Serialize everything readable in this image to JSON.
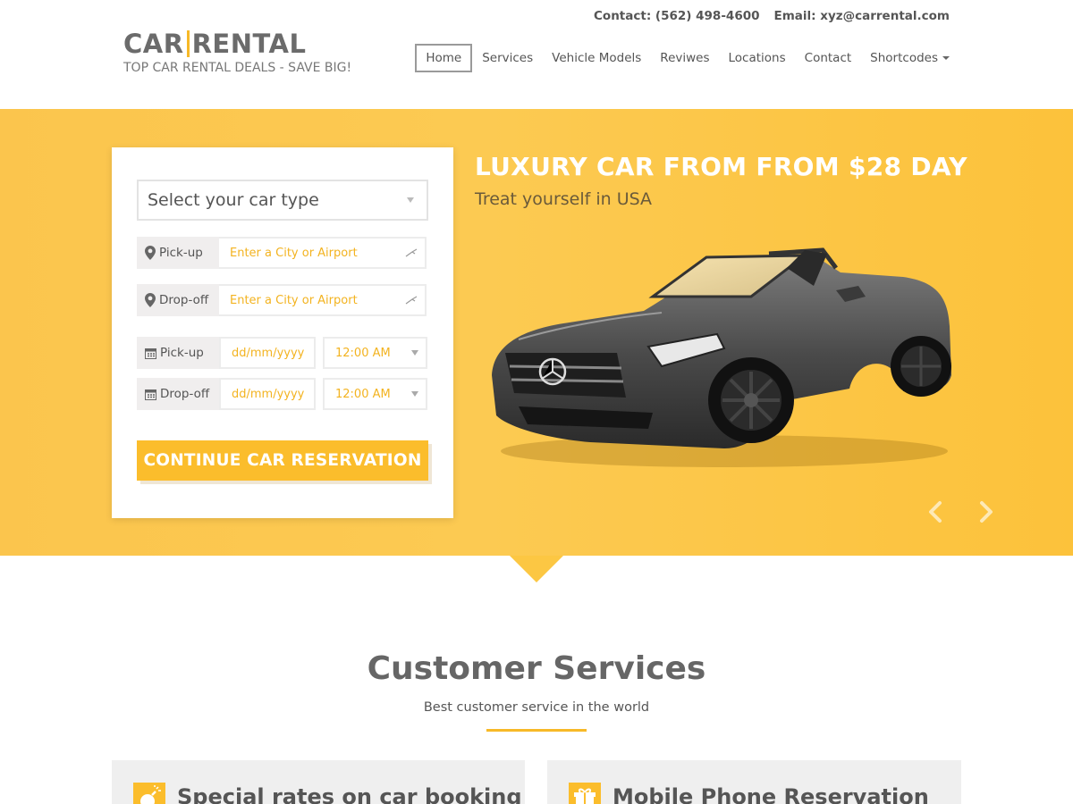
{
  "header": {
    "contact_phone": "Contact: (562) 498-4600",
    "contact_email": "Email: xyz@carrental.com",
    "logo_left": "CAR",
    "logo_right": "RENTAL",
    "tagline": "TOP CAR RENTAL DEALS - SAVE BIG!"
  },
  "nav": {
    "items": [
      {
        "label": "Home",
        "active": true
      },
      {
        "label": "Services"
      },
      {
        "label": "Vehicle Models"
      },
      {
        "label": "Reviwes"
      },
      {
        "label": "Locations"
      },
      {
        "label": "Contact"
      },
      {
        "label": "Shortcodes"
      }
    ]
  },
  "form": {
    "car_type": "Select your car type",
    "pickup_label": "Pick-up",
    "dropoff_label": "Drop-off",
    "location_placeholder": "Enter a City or Airport",
    "date_placeholder": "dd/mm/yyyy",
    "time_value": "12:00 AM",
    "submit": "CONTINUE CAR RESERVATION"
  },
  "hero": {
    "title": "LUXURY CAR FROM FROM $28 DAY",
    "subtitle": "Treat yourself in USA"
  },
  "services": {
    "title": "Customer Services",
    "subtitle": "Best customer service in the world",
    "cards": [
      {
        "title": "Special rates on car booking",
        "icon": "bomb-icon"
      },
      {
        "title": "Mobile Phone Reservation",
        "icon": "gift-icon"
      }
    ]
  },
  "colors": {
    "accent": "#fbbd2c",
    "hero_bg": "#fcc743",
    "text": "#555555"
  }
}
